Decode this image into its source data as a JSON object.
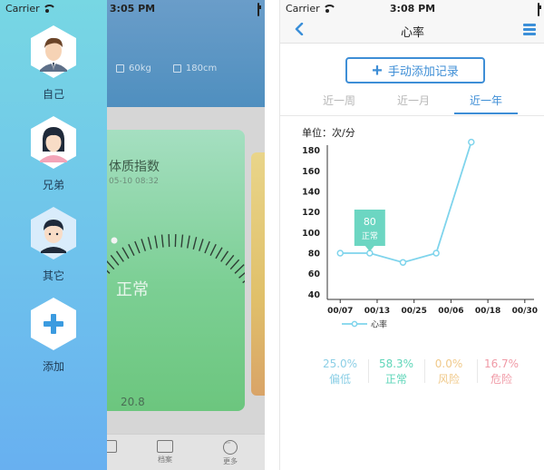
{
  "left": {
    "status": {
      "carrier": "Carrier",
      "time": "3:05 PM"
    },
    "stats": {
      "weight": "60kg",
      "height": "180cm"
    },
    "bmi_card": {
      "title": "体质指数",
      "date": "05-10 08:32",
      "status": "正常",
      "value": "20.8"
    },
    "tabs": [
      {
        "label": "",
        "icon": "book-icon"
      },
      {
        "label": "档案",
        "icon": "archive-icon"
      },
      {
        "label": "更多",
        "icon": "more-icon"
      }
    ],
    "drawer": {
      "profiles": [
        {
          "label": "自己",
          "icon": "male-avatar-icon"
        },
        {
          "label": "兄弟",
          "icon": "female-avatar-icon"
        },
        {
          "label": "其它",
          "icon": "child-avatar-icon"
        },
        {
          "label": "添加",
          "icon": "plus-icon"
        }
      ]
    }
  },
  "right": {
    "status": {
      "carrier": "Carrier",
      "time": "3:08 PM"
    },
    "nav": {
      "title": "心率"
    },
    "add_button": "手动添加记录",
    "period_tabs": [
      {
        "label": "近一周",
        "active": false
      },
      {
        "label": "近一月",
        "active": false
      },
      {
        "label": "近一年",
        "active": true
      }
    ],
    "unit_label": "单位：次/分",
    "summary": [
      {
        "pct": "25.0%",
        "label": "偏低",
        "color": "#8ccfe6"
      },
      {
        "pct": "58.3%",
        "label": "正常",
        "color": "#5fd6b9"
      },
      {
        "pct": "0.0%",
        "label": "风险",
        "color": "#f0c98a"
      },
      {
        "pct": "16.7%",
        "label": "危险",
        "color": "#f09aa6"
      }
    ]
  },
  "colors": {
    "accent": "#3e8ed6",
    "line": "#7fd4ec",
    "tooltip": "#6cd6c2"
  },
  "chart_data": {
    "type": "line",
    "categories": [
      "00/07",
      "00/13",
      "00/25",
      "00/06",
      "00/18",
      "00/30"
    ],
    "y_ticks": [
      40,
      60,
      80,
      100,
      120,
      140,
      160,
      180
    ],
    "ylim": [
      35,
      185
    ],
    "series": [
      {
        "name": "心率",
        "values": [
          80,
          80,
          71,
          80,
          188
        ]
      }
    ],
    "point_x": [
      0.35,
      1.15,
      2.05,
      2.95,
      3.9
    ],
    "tooltip": {
      "index": 1,
      "value": "80",
      "label": "正常"
    },
    "xlabel": "",
    "ylabel": "",
    "grid": false,
    "legend": "bottom-left"
  }
}
